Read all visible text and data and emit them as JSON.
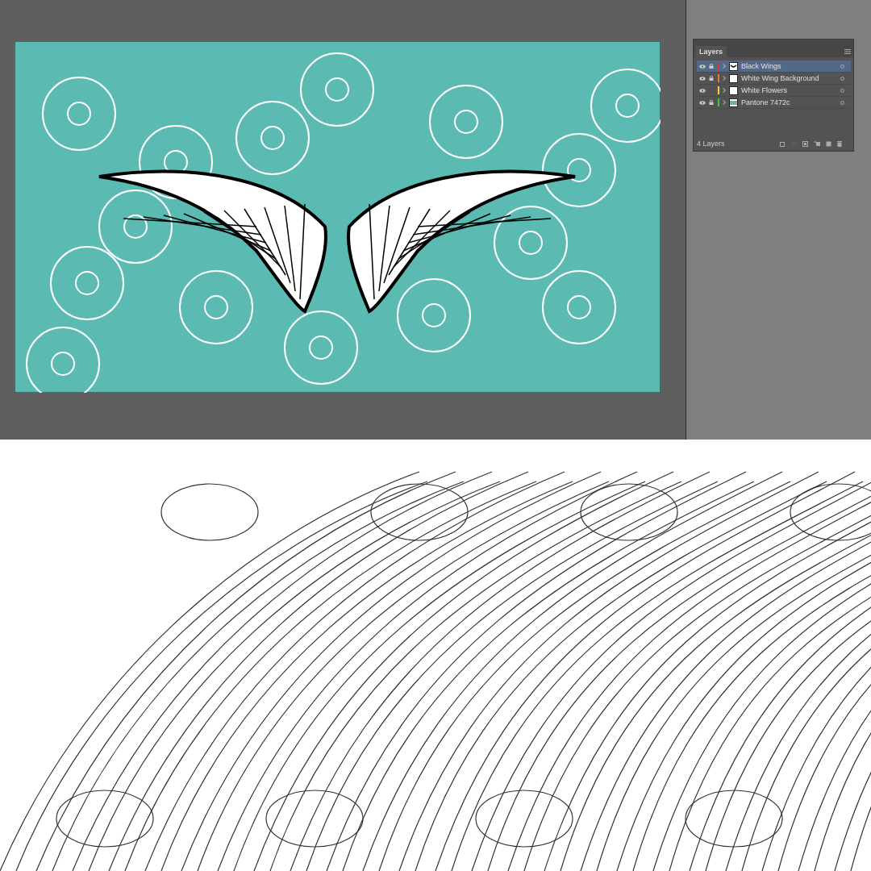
{
  "layers_panel": {
    "title": "Layers",
    "layers": [
      {
        "name": "Black Wings",
        "color": "#e8361e",
        "locked": true,
        "visible": true,
        "kind": "wings",
        "selected": true
      },
      {
        "name": "White Wing Background",
        "color": "#f07a1a",
        "locked": true,
        "visible": true,
        "kind": "white",
        "selected": false
      },
      {
        "name": "White Flowers",
        "color": "#e6d83a",
        "locked": false,
        "visible": true,
        "kind": "white",
        "selected": false
      },
      {
        "name": "Pantone 7472c",
        "color": "#3ec83e",
        "locked": true,
        "visible": true,
        "kind": "teal",
        "selected": false
      }
    ],
    "footer": "4 Layers"
  }
}
